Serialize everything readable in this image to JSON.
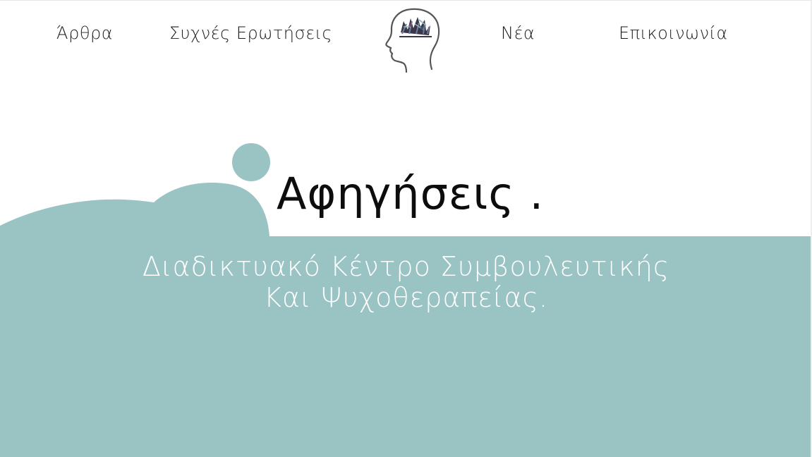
{
  "nav": {
    "items": [
      {
        "label": "Άρθρα"
      },
      {
        "label": "Συχνές Ερωτήσεις"
      },
      {
        "label": "Νέα"
      },
      {
        "label": "Επικοινωνία"
      }
    ],
    "logo_icon": "head-brain-logo-icon"
  },
  "hero": {
    "title": "Αφηγήσεις .",
    "subtitle_line1": "Διαδικτυακό Κέντρο Συμβουλευτικής",
    "subtitle_line2": "Και Ψυχοθεραπείας."
  },
  "colors": {
    "accent": "#9ac3c3",
    "text": "#0d0d0d",
    "background": "#ffffff"
  }
}
